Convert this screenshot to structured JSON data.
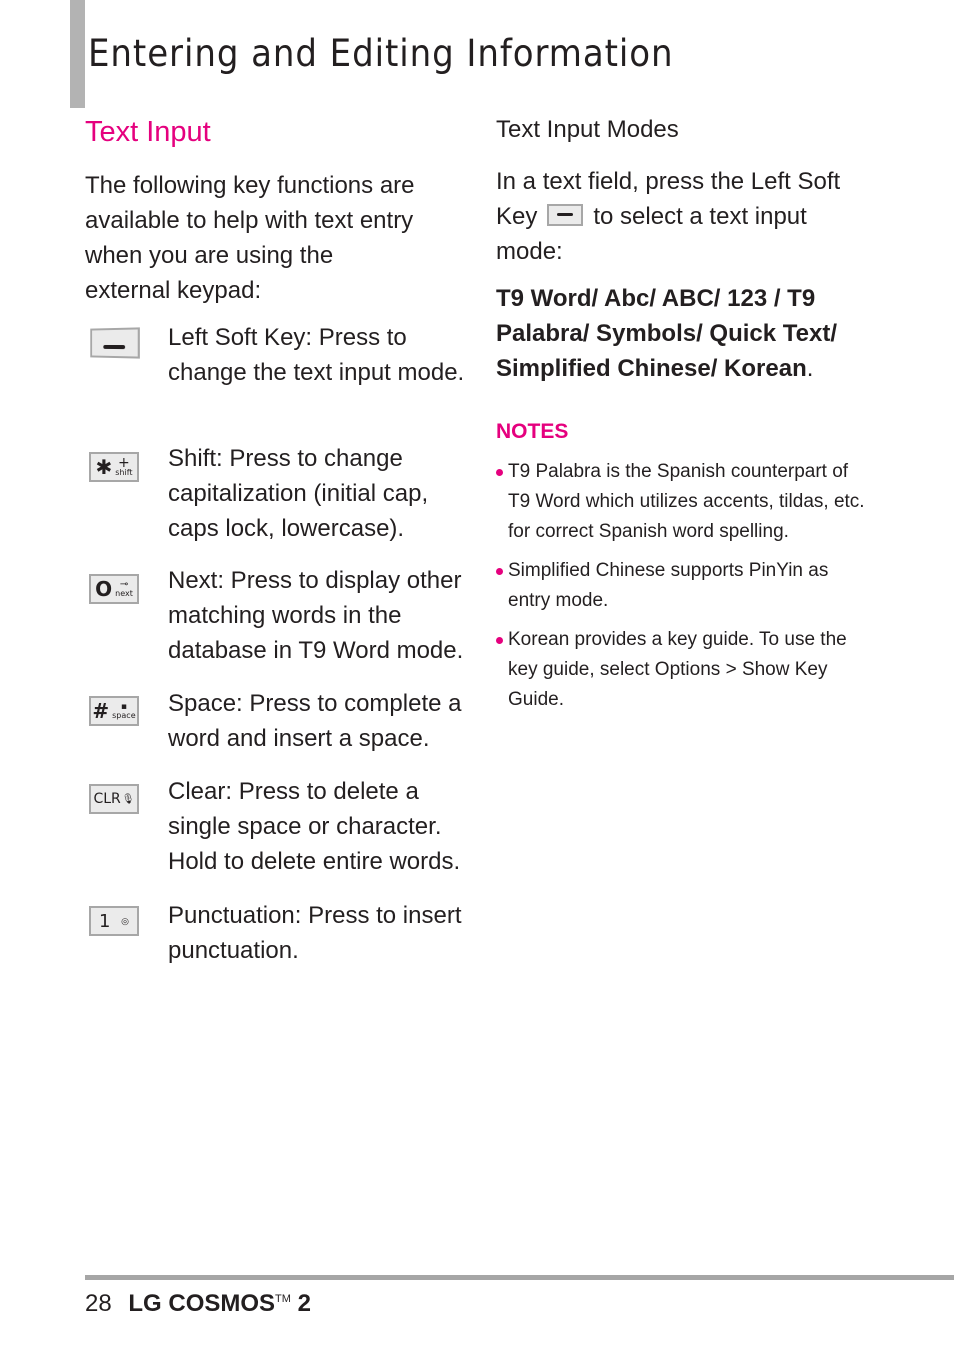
{
  "header": {
    "title": "Entering and Editing Information"
  },
  "text_input": {
    "heading": "Text Input",
    "intro": "The following key functions are available to help with text entry when you are using the external keypad:",
    "keys": [
      {
        "icon": "left-soft-key-icon",
        "description": "Left Soft Key: Press to change the text input mode."
      },
      {
        "icon": "shift-key-icon",
        "glyph": "✱",
        "sub": "shift",
        "sub_symbol": "+",
        "description": "Shift: Press to change capitalization (initial cap, caps lock, lowercase)."
      },
      {
        "icon": "next-key-icon",
        "glyph": "O",
        "sub": "next",
        "sub_symbol": "⊸",
        "description": "Next: Press to display other matching words in the database in T9 Word mode."
      },
      {
        "icon": "space-key-icon",
        "glyph": "#",
        "sub": "space",
        "sub_symbol": "▪",
        "description": "Space: Press to complete a word and insert a space."
      },
      {
        "icon": "clear-key-icon",
        "glyph": "CLR",
        "sub_symbol": "🎙",
        "description": "Clear: Press to delete a single space or character. Hold to delete entire words."
      },
      {
        "icon": "punctuation-key-icon",
        "glyph": "1",
        "sub_symbol": "◎",
        "description": "Punctuation: Press to insert punctuation."
      }
    ]
  },
  "text_input_modes": {
    "heading": "Text Input Modes",
    "intro_before": "In a text field, press the Left Soft Key",
    "intro_after": "to select a text input mode:",
    "modes": "T9 Word/ Abc/ ABC/ 123 / T9 Palabra/ Symbols/ Quick Text/ Simplified Chinese/ Korean",
    "modes_end": "."
  },
  "notes": {
    "heading": "NOTES",
    "items": [
      "T9 Palabra is the Spanish counterpart of T9 Word which utilizes accents, tildas, etc. for correct Spanish word spelling.",
      "Simplified Chinese supports PinYin as entry mode.",
      "Korean provides a key guide. To use the key guide, select Options > Show Key Guide."
    ]
  },
  "footer": {
    "page_number": "28",
    "brand": "LG COSMOS",
    "trademark": "TM",
    "model": "2"
  },
  "colors": {
    "accent": "#e5007e",
    "text": "#231f20",
    "rule": "#a6a6a6"
  }
}
